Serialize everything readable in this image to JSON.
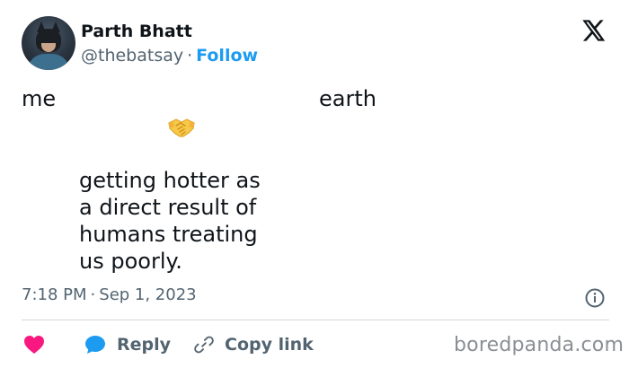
{
  "author": {
    "name": "Parth Bhatt",
    "handle": "@thebatsay",
    "separator": "·",
    "follow_label": "Follow"
  },
  "tweet": {
    "label_left": "me",
    "label_right": "earth",
    "emoji": "handshake-emoji",
    "lines": [
      "getting hotter as",
      "a direct result of",
      "humans treating",
      "us poorly."
    ]
  },
  "meta": {
    "time": "7:18 PM",
    "separator": "·",
    "date": "Sep 1, 2023"
  },
  "actions": {
    "like_icon": "heart-icon",
    "reply_label": "Reply",
    "copy_label": "Copy link"
  },
  "watermark": "boredpanda.com",
  "colors": {
    "accent": "#1d9bf0",
    "like": "#f91880",
    "text": "#0f1419",
    "muted": "#536471",
    "divider": "#cfd9de"
  }
}
